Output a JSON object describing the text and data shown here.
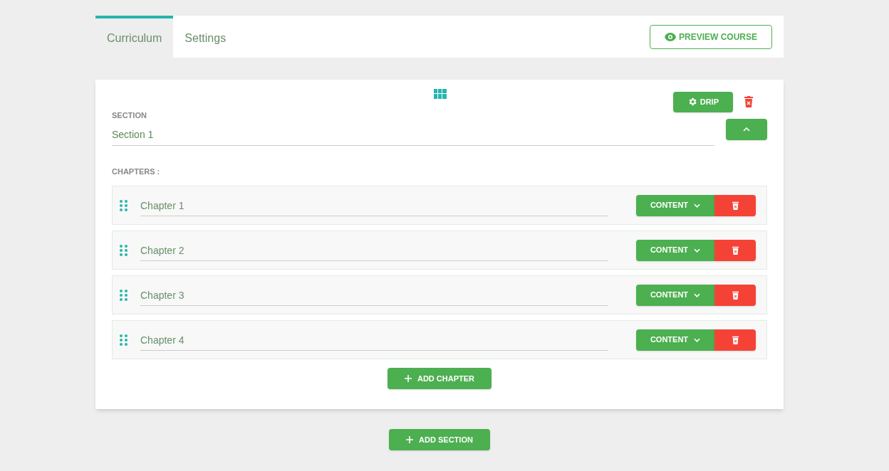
{
  "tabs": [
    {
      "label": "Curriculum",
      "selected": true
    },
    {
      "label": "Settings",
      "selected": false
    }
  ],
  "preview_button": "PREVIEW COURSE",
  "section": {
    "drip_button": "DRIP",
    "label": "SECTION",
    "value": "Section 1",
    "expanded": true,
    "chapters_label": "CHAPTERS :",
    "chapters": [
      {
        "value": "Chapter 1",
        "button": "CONTENT"
      },
      {
        "value": "Chapter 2",
        "button": "CONTENT"
      },
      {
        "value": "Chapter 3",
        "button": "CONTENT"
      },
      {
        "value": "Chapter 4",
        "button": "CONTENT"
      }
    ],
    "add_chapter_button": "ADD CHAPTER"
  },
  "add_section_button": "ADD SECTION"
}
